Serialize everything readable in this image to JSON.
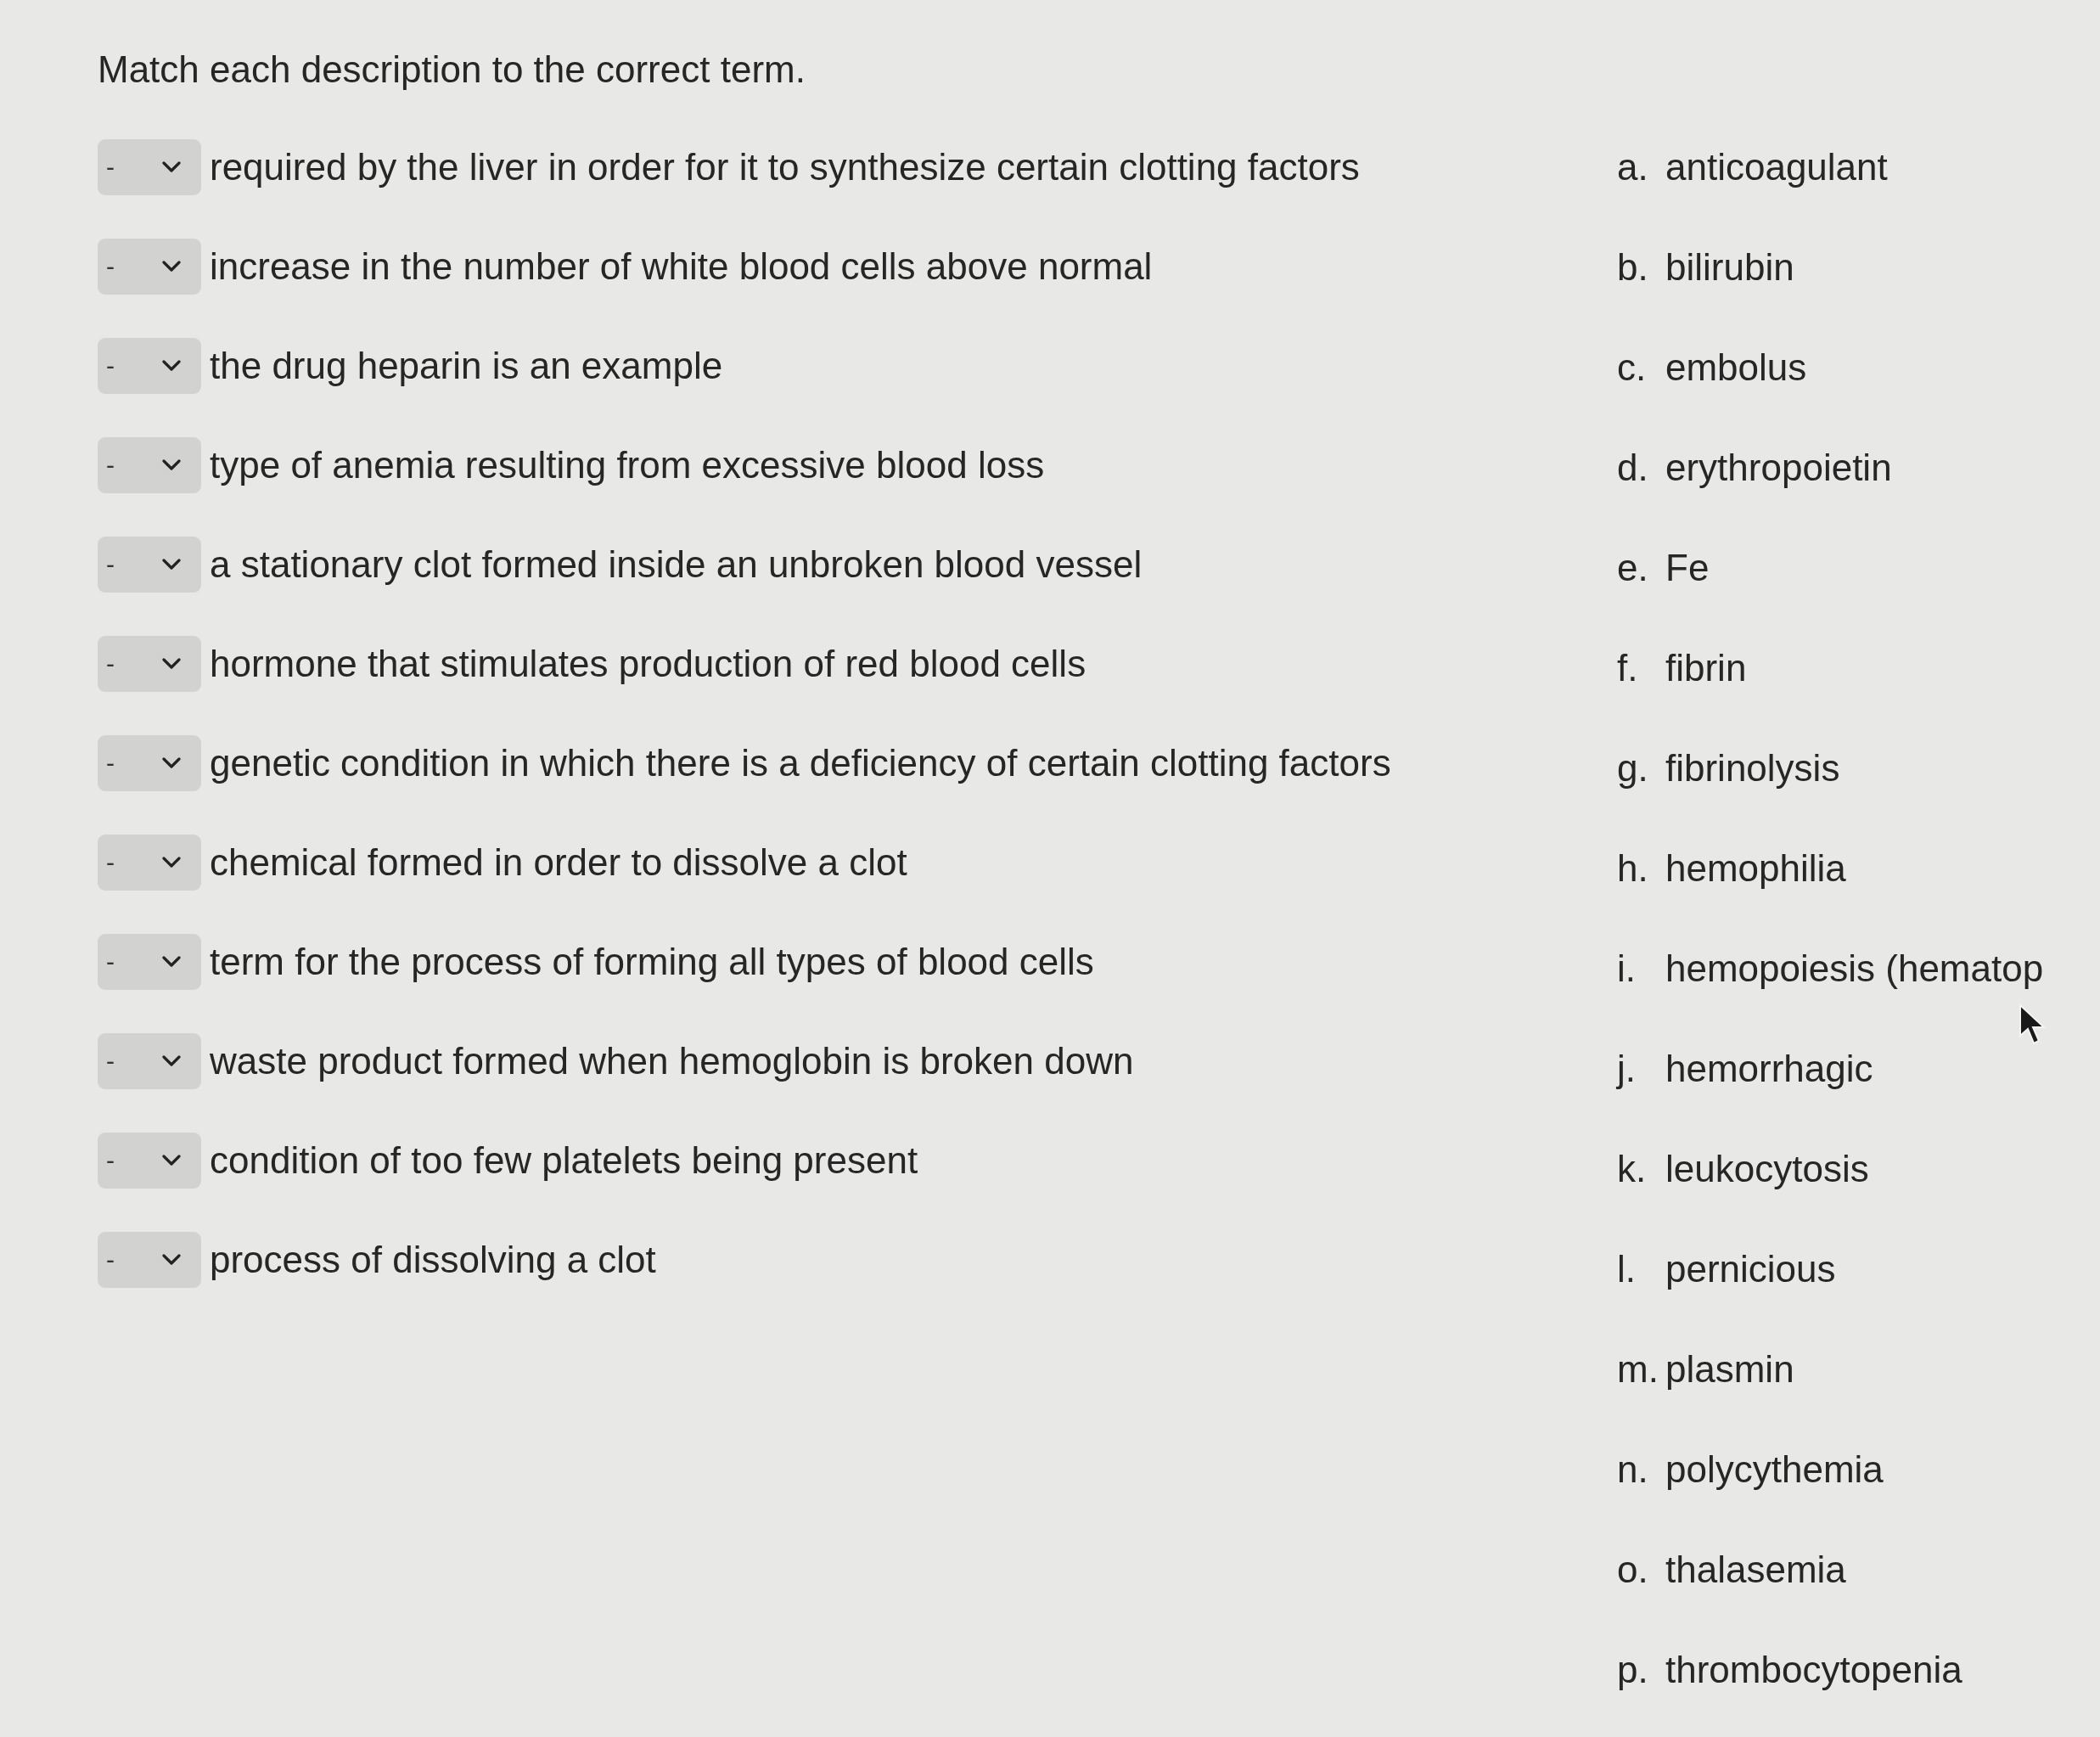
{
  "instruction": "Match each description to the correct term.",
  "matches": [
    {
      "value": "-",
      "description": "required by the liver in order for it to synthesize certain clotting factors"
    },
    {
      "value": "-",
      "description": "increase in the number of white blood cells above normal"
    },
    {
      "value": "-",
      "description": "the drug heparin is an example"
    },
    {
      "value": "-",
      "description": "type of anemia resulting from excessive blood loss"
    },
    {
      "value": "-",
      "description": "a stationary clot formed inside an unbroken blood vessel"
    },
    {
      "value": "-",
      "description": "hormone that stimulates production of red blood cells"
    },
    {
      "value": "-",
      "description": "genetic condition in which there is a deficiency of certain clotting factors"
    },
    {
      "value": "-",
      "description": "chemical formed in order to dissolve a clot"
    },
    {
      "value": "-",
      "description": "term for the process of forming all types of blood cells"
    },
    {
      "value": "-",
      "description": "waste product formed when hemoglobin is broken down"
    },
    {
      "value": "-",
      "description": "condition of too few platelets being present"
    },
    {
      "value": "-",
      "description": "process of dissolving a clot"
    }
  ],
  "terms": [
    {
      "letter": "a.",
      "term": "anticoagulant"
    },
    {
      "letter": "b.",
      "term": "bilirubin"
    },
    {
      "letter": "c.",
      "term": "embolus"
    },
    {
      "letter": "d.",
      "term": "erythropoietin"
    },
    {
      "letter": "e.",
      "term": "Fe"
    },
    {
      "letter": "f.",
      "term": "fibrin"
    },
    {
      "letter": "g.",
      "term": "fibrinolysis"
    },
    {
      "letter": "h.",
      "term": "hemophilia"
    },
    {
      "letter": "i.",
      "term": "hemopoiesis (hematop"
    },
    {
      "letter": "j.",
      "term": "hemorrhagic"
    },
    {
      "letter": "k.",
      "term": "leukocytosis"
    },
    {
      "letter": "l.",
      "term": "pernicious"
    },
    {
      "letter": "m.",
      "term": "plasmin"
    },
    {
      "letter": "n.",
      "term": "polycythemia"
    },
    {
      "letter": "o.",
      "term": "thalasemia"
    },
    {
      "letter": "p.",
      "term": "thrombocytopenia"
    }
  ]
}
